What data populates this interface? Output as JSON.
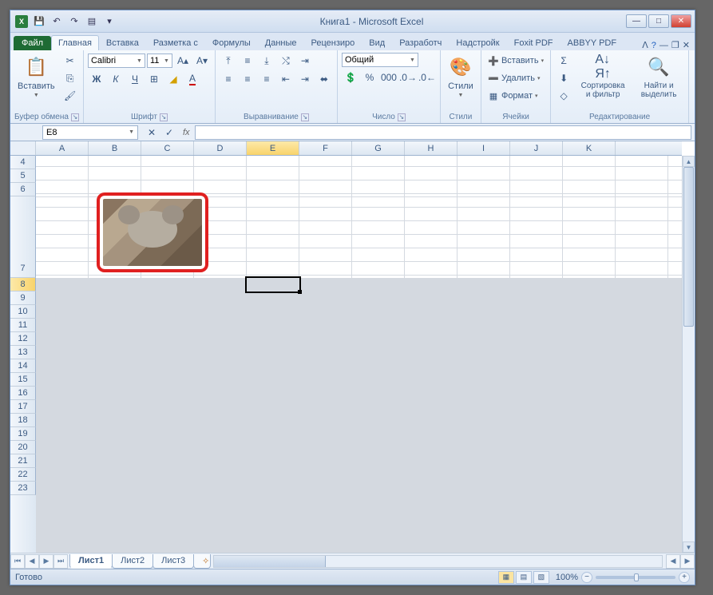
{
  "title": "Книга1 - Microsoft Excel",
  "qat_icons": [
    "excel",
    "save",
    "undo",
    "redo",
    "print",
    "customize"
  ],
  "tabs": {
    "file": "Файл",
    "items": [
      "Главная",
      "Вставка",
      "Разметка с",
      "Формулы",
      "Данные",
      "Рецензиро",
      "Вид",
      "Разработч",
      "Надстройк",
      "Foxit PDF",
      "ABBYY PDF"
    ],
    "active": 0
  },
  "ribbon": {
    "clipboard": {
      "label": "Буфер обмена",
      "paste": "Вставить"
    },
    "font": {
      "label": "Шрифт",
      "name": "Calibri",
      "size": "11",
      "bold": "Ж",
      "italic": "К",
      "underline": "Ч"
    },
    "align": {
      "label": "Выравнивание"
    },
    "number": {
      "label": "Число",
      "format": "Общий"
    },
    "styles": {
      "label": "Стили",
      "btn": "Стили"
    },
    "cells": {
      "label": "Ячейки",
      "insert": "Вставить",
      "delete": "Удалить",
      "format": "Формат"
    },
    "editing": {
      "label": "Редактирование",
      "sort": "Сортировка и фильтр",
      "find": "Найти и выделить"
    }
  },
  "namebox": "E8",
  "columns": [
    "A",
    "B",
    "C",
    "D",
    "E",
    "F",
    "G",
    "H",
    "I",
    "J",
    "K"
  ],
  "rows_before": [
    4,
    5,
    6
  ],
  "row_tall": 7,
  "rows_after": [
    8,
    9,
    10,
    11,
    12,
    13,
    14,
    15,
    16,
    17,
    18,
    19,
    20,
    21,
    22,
    23
  ],
  "selected": {
    "col": "E",
    "row": 8
  },
  "embedded_image": {
    "type": "photo",
    "subject": "koala",
    "highlight": "red-rounded-border",
    "anchor_cell": "B7"
  },
  "sheets": {
    "items": [
      "Лист1",
      "Лист2",
      "Лист3"
    ],
    "active": 0
  },
  "status": "Готово",
  "zoom": "100%"
}
